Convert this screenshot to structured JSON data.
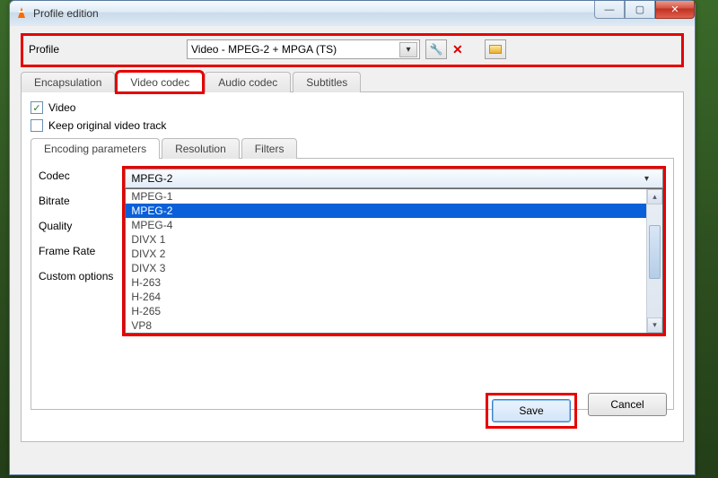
{
  "window": {
    "title": "Profile edition"
  },
  "profile": {
    "label": "Profile",
    "selected": "Video - MPEG-2 + MPGA (TS)"
  },
  "tabs": {
    "encapsulation": "Encapsulation",
    "video_codec": "Video codec",
    "audio_codec": "Audio codec",
    "subtitles": "Subtitles"
  },
  "video_checkbox": "Video",
  "keep_original": "Keep original video track",
  "subtabs": {
    "encoding": "Encoding parameters",
    "resolution": "Resolution",
    "filters": "Filters"
  },
  "params": {
    "codec": "Codec",
    "bitrate": "Bitrate",
    "quality": "Quality",
    "framerate": "Frame Rate",
    "custom": "Custom options"
  },
  "codec_selected": "MPEG-2",
  "codec_options": {
    "o0": "MPEG-1",
    "o1": "MPEG-2",
    "o2": "MPEG-4",
    "o3": "DIVX 1",
    "o4": "DIVX 2",
    "o5": "DIVX 3",
    "o6": "H-263",
    "o7": "H-264",
    "o8": "H-265",
    "o9": "VP8"
  },
  "buttons": {
    "save": "Save",
    "cancel": "Cancel"
  }
}
